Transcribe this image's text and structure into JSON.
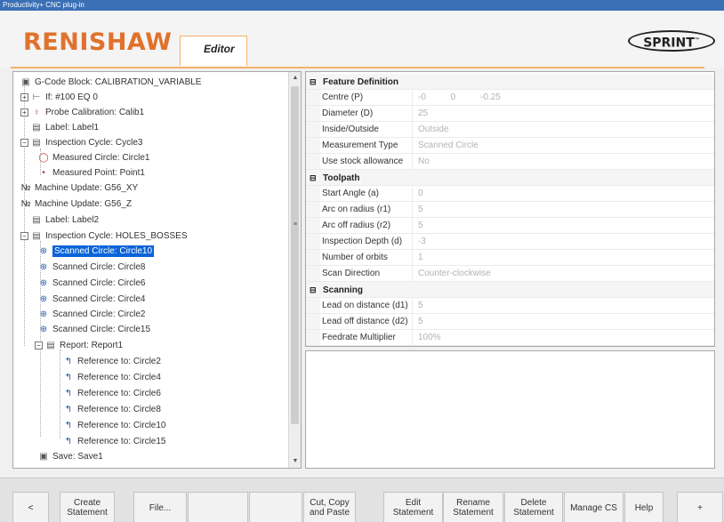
{
  "window": {
    "title": "Productivity+ CNC plug-in"
  },
  "header": {
    "brand": "RENISHAW",
    "tab": "Editor",
    "product_logo": "SPRINT",
    "product_logo_tm": "™"
  },
  "tree": {
    "items": [
      {
        "icon": "gcode-icon",
        "glyph": "▣",
        "label": "G-Code Block: CALIBRATION_VARIABLE"
      },
      {
        "icon": "if-icon",
        "glyph": "⊢",
        "label": "If: #100 EQ 0"
      },
      {
        "icon": "probe-icon",
        "glyph": "♀",
        "label": "Probe Calibration: Calib1"
      },
      {
        "icon": "label-icon",
        "glyph": "▤",
        "label": "Label: Label1"
      },
      {
        "icon": "inspection-icon",
        "glyph": "▤",
        "label": "Inspection Cycle: Cycle3"
      },
      {
        "icon": "measured-circle-icon",
        "glyph": "◯",
        "label": "Measured Circle: Circle1"
      },
      {
        "icon": "measured-point-icon",
        "glyph": "•",
        "label": "Measured Point: Point1"
      },
      {
        "icon": "nc-icon",
        "glyph": "№",
        "label": "Machine Update: G56_XY"
      },
      {
        "icon": "nc-icon",
        "glyph": "№",
        "label": "Machine Update: G56_Z"
      },
      {
        "icon": "label-icon",
        "glyph": "▤",
        "label": "Label: Label2"
      },
      {
        "icon": "inspection-icon",
        "glyph": "▤",
        "label": "Inspection Cycle: HOLES_BOSSES"
      },
      {
        "icon": "scanned-circle-icon",
        "glyph": "⊕",
        "label": "Scanned Circle: Circle10"
      },
      {
        "icon": "scanned-circle-icon",
        "glyph": "⊕",
        "label": "Scanned Circle: Circle8"
      },
      {
        "icon": "scanned-circle-icon",
        "glyph": "⊕",
        "label": "Scanned Circle: Circle6"
      },
      {
        "icon": "scanned-circle-icon",
        "glyph": "⊕",
        "label": "Scanned Circle: Circle4"
      },
      {
        "icon": "scanned-circle-icon",
        "glyph": "⊕",
        "label": "Scanned Circle: Circle2"
      },
      {
        "icon": "scanned-circle-icon",
        "glyph": "⊕",
        "label": "Scanned Circle: Circle15"
      },
      {
        "icon": "report-icon",
        "glyph": "▤",
        "label": "Report: Report1"
      },
      {
        "icon": "reference-icon",
        "glyph": "↰",
        "label": "Reference to: Circle2"
      },
      {
        "icon": "reference-icon",
        "glyph": "↰",
        "label": "Reference to: Circle4"
      },
      {
        "icon": "reference-icon",
        "glyph": "↰",
        "label": "Reference to: Circle6"
      },
      {
        "icon": "reference-icon",
        "glyph": "↰",
        "label": "Reference to: Circle8"
      },
      {
        "icon": "reference-icon",
        "glyph": "↰",
        "label": "Reference to: Circle10"
      },
      {
        "icon": "reference-icon",
        "glyph": "↰",
        "label": "Reference to: Circle15"
      },
      {
        "icon": "save-icon",
        "glyph": "▣",
        "label": "Save: Save1"
      }
    ],
    "selected_label": "Scanned Circle: Circle10"
  },
  "properties": {
    "sections": [
      {
        "title": "Feature Definition",
        "rows": [
          {
            "name": "Centre (P)",
            "value": "-0          0          -0.25"
          },
          {
            "name": "Diameter (D)",
            "value": "25"
          },
          {
            "name": "Inside/Outside",
            "value": "Outside"
          },
          {
            "name": "Measurement Type",
            "value": "Scanned Circle"
          },
          {
            "name": "Use stock allowance",
            "value": "No"
          }
        ]
      },
      {
        "title": "Toolpath",
        "rows": [
          {
            "name": "Start Angle (a)",
            "value": "0"
          },
          {
            "name": "Arc on radius (r1)",
            "value": "5"
          },
          {
            "name": "Arc off radius (r2)",
            "value": "5"
          },
          {
            "name": "Inspection Depth (d)",
            "value": "-3"
          },
          {
            "name": "Number of orbits",
            "value": "1"
          },
          {
            "name": "Scan Direction",
            "value": "Counter-clockwise"
          }
        ]
      },
      {
        "title": "Scanning",
        "rows": [
          {
            "name": "Lead on distance (d1)",
            "value": "5"
          },
          {
            "name": "Lead off distance (d2)",
            "value": "5"
          },
          {
            "name": "Feedrate Multiplier",
            "value": "100%"
          }
        ]
      }
    ],
    "collapse_glyph": "⊟"
  },
  "toolbar": {
    "buttons": [
      {
        "label": "<"
      },
      {
        "label": "Create\nStatement"
      },
      {
        "label": "File..."
      },
      {
        "label": ""
      },
      {
        "label": ""
      },
      {
        "label": "Cut, Copy\nand Paste"
      },
      {
        "label": ""
      },
      {
        "label": "Edit\nStatement"
      },
      {
        "label": "Rename\nStatement"
      },
      {
        "label": "Delete\nStatement"
      },
      {
        "label": "Manage CS"
      },
      {
        "label": "Help"
      },
      {
        "label": "+"
      }
    ]
  },
  "scroll": {
    "up": "▲",
    "down": "▼",
    "grip": "≡"
  }
}
